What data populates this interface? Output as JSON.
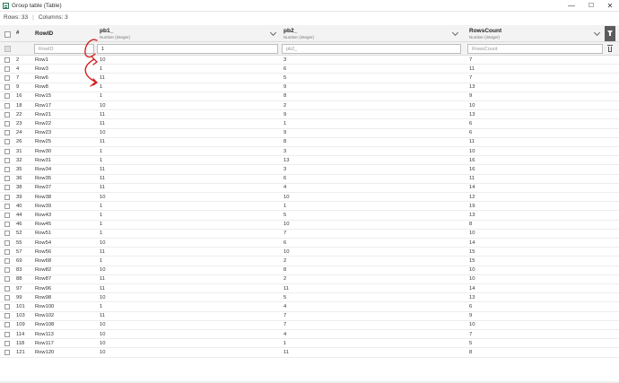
{
  "window": {
    "title": "Group table (Table)",
    "minimize_glyph": "—",
    "maximize_glyph": "☐",
    "close_glyph": "✕"
  },
  "summary": {
    "rows_label": "Rows: 33",
    "columns_label": "Columns: 3"
  },
  "table": {
    "index_header": "#",
    "columns": [
      {
        "title": "RowID",
        "type": ""
      },
      {
        "title": "pb1_",
        "type": "Number (integer)"
      },
      {
        "title": "pb2_",
        "type": "Number (integer)"
      },
      {
        "title": "RowsCount",
        "type": "Number (integer)"
      }
    ],
    "filters": {
      "rowid_placeholder": "RowID",
      "pb1_value": "1",
      "pb2_placeholder": "pb2_",
      "rowscount_placeholder": "RowsCount"
    },
    "rows": [
      [
        "2",
        "Row1",
        "10",
        "3",
        "7"
      ],
      [
        "4",
        "Row3",
        "1",
        "6",
        "11"
      ],
      [
        "7",
        "Row6",
        "11",
        "5",
        "7"
      ],
      [
        "9",
        "Row8",
        "1",
        "9",
        "13"
      ],
      [
        "16",
        "Row15",
        "1",
        "8",
        "9"
      ],
      [
        "18",
        "Row17",
        "10",
        "2",
        "10"
      ],
      [
        "22",
        "Row21",
        "11",
        "9",
        "13"
      ],
      [
        "23",
        "Row22",
        "11",
        "1",
        "6"
      ],
      [
        "24",
        "Row23",
        "10",
        "9",
        "6"
      ],
      [
        "26",
        "Row25",
        "11",
        "8",
        "11"
      ],
      [
        "31",
        "Row30",
        "1",
        "3",
        "10"
      ],
      [
        "32",
        "Row31",
        "1",
        "13",
        "16"
      ],
      [
        "35",
        "Row34",
        "11",
        "3",
        "16"
      ],
      [
        "36",
        "Row35",
        "11",
        "6",
        "11"
      ],
      [
        "38",
        "Row37",
        "11",
        "4",
        "14"
      ],
      [
        "39",
        "Row38",
        "10",
        "10",
        "12"
      ],
      [
        "40",
        "Row39",
        "1",
        "1",
        "19"
      ],
      [
        "44",
        "Row43",
        "1",
        "5",
        "13"
      ],
      [
        "46",
        "Row45",
        "1",
        "10",
        "8"
      ],
      [
        "52",
        "Row51",
        "1",
        "7",
        "10"
      ],
      [
        "55",
        "Row54",
        "10",
        "6",
        "14"
      ],
      [
        "57",
        "Row56",
        "11",
        "10",
        "15"
      ],
      [
        "69",
        "Row68",
        "1",
        "2",
        "15"
      ],
      [
        "83",
        "Row82",
        "10",
        "8",
        "10"
      ],
      [
        "88",
        "Row87",
        "11",
        "2",
        "10"
      ],
      [
        "97",
        "Row96",
        "11",
        "11",
        "14"
      ],
      [
        "99",
        "Row98",
        "10",
        "5",
        "13"
      ],
      [
        "101",
        "Row100",
        "1",
        "4",
        "6"
      ],
      [
        "103",
        "Row102",
        "11",
        "7",
        "9"
      ],
      [
        "109",
        "Row108",
        "10",
        "7",
        "10"
      ],
      [
        "114",
        "Row113",
        "10",
        "4",
        "7"
      ],
      [
        "118",
        "Row117",
        "10",
        "1",
        "5"
      ],
      [
        "121",
        "Row120",
        "10",
        "11",
        "8"
      ]
    ]
  },
  "icons": {
    "window": "table-icon",
    "filter": "funnel-icon",
    "clear": "trash-icon",
    "sort": "chevron-down-icon"
  },
  "colors": {
    "header_bg": "#f3f3f3",
    "filter_button": "#5c5c5c",
    "annotation": "#d42020"
  }
}
